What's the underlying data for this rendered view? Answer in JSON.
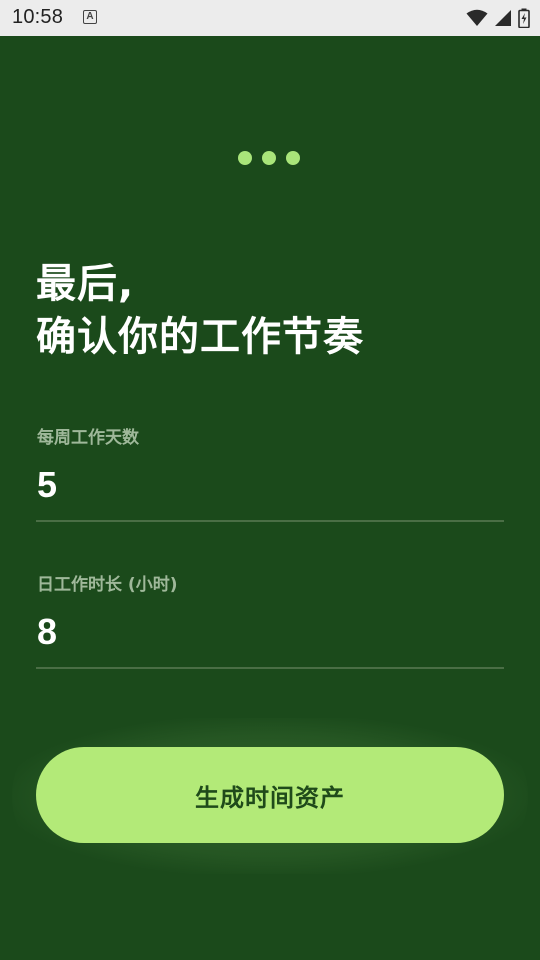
{
  "status_bar": {
    "time": "10:58",
    "notification_letter": "A"
  },
  "progress": {
    "steps": 3
  },
  "heading": {
    "line1": "最后,",
    "line2": "确认你的工作节奏"
  },
  "fields": {
    "days_per_week": {
      "label": "每周工作天数",
      "value": "5"
    },
    "hours_per_day": {
      "label": "日工作时长 (小时)",
      "value": "8"
    }
  },
  "actions": {
    "submit_label": "生成时间资产"
  },
  "colors": {
    "background": "#1b4a1b",
    "accent": "#b3ea78",
    "dot": "#a9e57a",
    "label": "#9fb89a"
  }
}
